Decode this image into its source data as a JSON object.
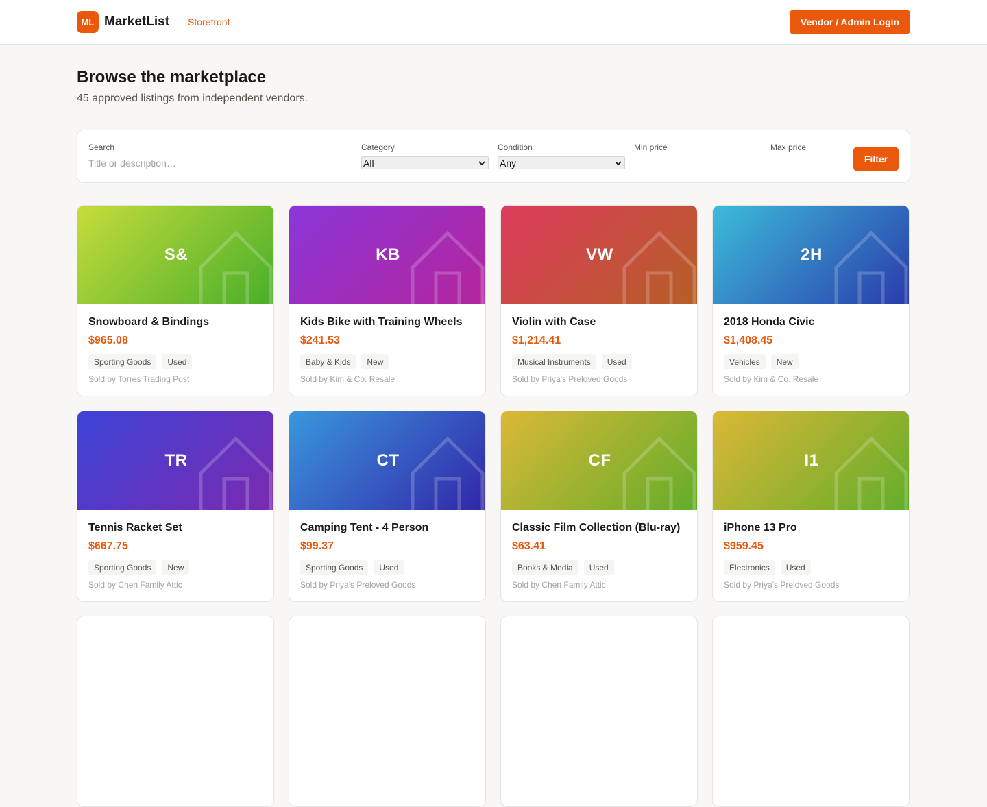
{
  "header": {
    "logo_text": "ML",
    "brand": "MarketList",
    "nav_link": "Storefront",
    "login_label": "Vendor / Admin Login"
  },
  "page": {
    "title": "Browse the marketplace",
    "subtitle": "45 approved listings from independent vendors."
  },
  "filters": {
    "search_label": "Search",
    "search_placeholder": "Title or description…",
    "search_value": "",
    "category_label": "Category",
    "category_value": "All",
    "condition_label": "Condition",
    "condition_value": "Any",
    "min_price_label": "Min price",
    "min_price_value": "",
    "max_price_label": "Max price",
    "max_price_value": "",
    "filter_button": "Filter"
  },
  "colors": {
    "accent": "#ea580c"
  },
  "listings": [
    {
      "initials": "S&",
      "title": "Snowboard & Bindings",
      "price": "$965.08",
      "category": "Sporting Goods",
      "condition": "Used",
      "seller": "Sold by Torres Trading Post",
      "gradient": [
        "#c6dc3c",
        "#48ae2a"
      ]
    },
    {
      "initials": "KB",
      "title": "Kids Bike with Training Wheels",
      "price": "$241.53",
      "category": "Baby & Kids",
      "condition": "New",
      "seller": "Sold by Kim & Co. Resale",
      "gradient": [
        "#8b36d9",
        "#b4259c"
      ]
    },
    {
      "initials": "VW",
      "title": "Violin with Case",
      "price": "$1,214.41",
      "category": "Musical Instruments",
      "condition": "Used",
      "seller": "Sold by Priya's Preloved Goods",
      "gradient": [
        "#dd3c5c",
        "#b45f26"
      ]
    },
    {
      "initials": "2H",
      "title": "2018 Honda Civic",
      "price": "$1,408.45",
      "category": "Vehicles",
      "condition": "New",
      "seller": "Sold by Kim & Co. Resale",
      "gradient": [
        "#3dbcd9",
        "#2a3aab"
      ]
    },
    {
      "initials": "TR",
      "title": "Tennis Racket Set",
      "price": "$667.75",
      "category": "Sporting Goods",
      "condition": "New",
      "seller": "Sold by Chen Family Attic",
      "gradient": [
        "#3d43d6",
        "#7b2ab0"
      ]
    },
    {
      "initials": "CT",
      "title": "Camping Tent - 4 Person",
      "price": "$99.37",
      "category": "Sporting Goods",
      "condition": "Used",
      "seller": "Sold by Priya's Preloved Goods",
      "gradient": [
        "#3a97dc",
        "#3225a8"
      ]
    },
    {
      "initials": "CF",
      "title": "Classic Film Collection (Blu-ray)",
      "price": "$63.41",
      "category": "Books & Media",
      "condition": "Used",
      "seller": "Sold by Chen Family Attic",
      "gradient": [
        "#dcb837",
        "#62ad2a"
      ]
    },
    {
      "initials": "I1",
      "title": "iPhone 13 Pro",
      "price": "$959.45",
      "category": "Electronics",
      "condition": "Used",
      "seller": "Sold by Priya's Preloved Goods",
      "gradient": [
        "#dcb837",
        "#62ad2a"
      ]
    }
  ]
}
